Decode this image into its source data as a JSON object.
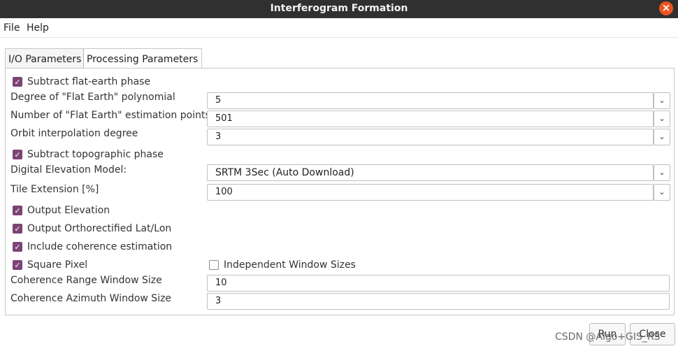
{
  "window": {
    "title": "Interferogram Formation",
    "close_glyph": "×"
  },
  "menu": {
    "items": [
      "File",
      "Help"
    ]
  },
  "tabs": [
    {
      "label": "I/O Parameters",
      "active": false
    },
    {
      "label": "Processing Parameters",
      "active": true
    }
  ],
  "form": {
    "subtract_flat_earth": {
      "label": "Subtract flat-earth phase",
      "checked": true
    },
    "flat_earth_degree": {
      "label": "Degree of \"Flat Earth\" polynomial",
      "value": "5"
    },
    "flat_earth_points": {
      "label": "Number of \"Flat Earth\" estimation points",
      "value": "501"
    },
    "orbit_degree": {
      "label": "Orbit interpolation degree",
      "value": "3"
    },
    "subtract_topo": {
      "label": "Subtract topographic phase",
      "checked": true
    },
    "dem": {
      "label": "Digital Elevation Model:",
      "value": "SRTM 3Sec (Auto Download)"
    },
    "tile_extension": {
      "label": "Tile Extension [%]",
      "value": "100"
    },
    "output_elevation": {
      "label": "Output Elevation",
      "checked": true
    },
    "output_latlon": {
      "label": "Output Orthorectified Lat/Lon",
      "checked": true
    },
    "include_coherence": {
      "label": "Include coherence estimation",
      "checked": true
    },
    "square_pixel": {
      "label": "Square Pixel",
      "checked": true
    },
    "independent_windows": {
      "label": "Independent Window Sizes",
      "checked": false
    },
    "coh_range": {
      "label": "Coherence Range Window Size",
      "value": "10"
    },
    "coh_azimuth": {
      "label": "Coherence Azimuth Window Size",
      "value": "3"
    }
  },
  "buttons": {
    "run": "Run",
    "close": "Close"
  },
  "watermark": "CSDN @Algo+GIS_RS",
  "icons": {
    "check": "✓",
    "dropdown": "⌄"
  },
  "colors": {
    "titlebar": "#303030",
    "close_button": "#e95420",
    "checkbox_checked": "#7c4375"
  }
}
